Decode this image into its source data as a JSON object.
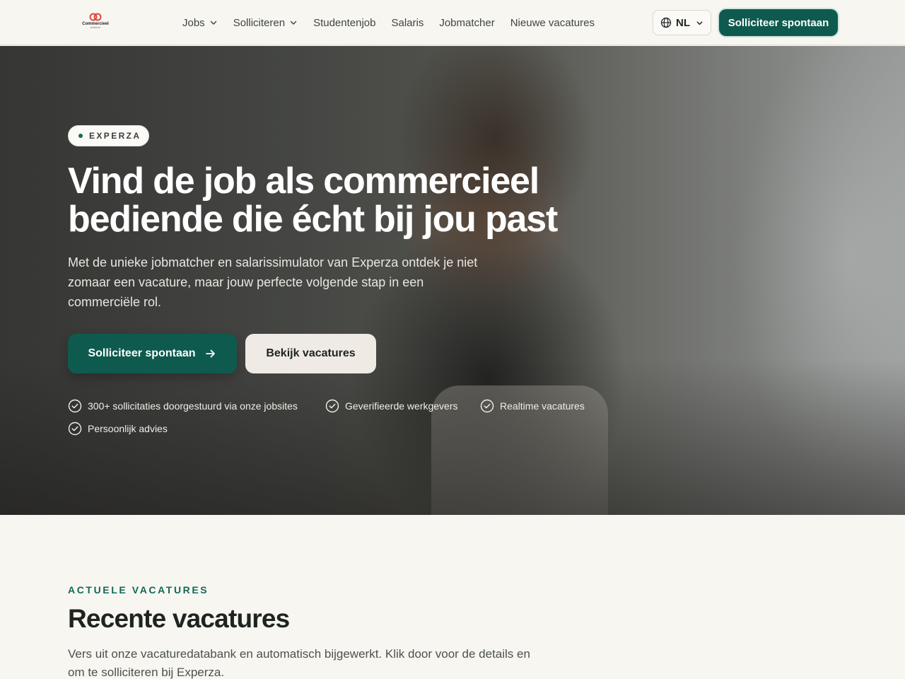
{
  "header": {
    "logo": {
      "text": "Commercieel",
      "sub": "bediende"
    },
    "nav": [
      {
        "label": "Jobs",
        "has_dropdown": true
      },
      {
        "label": "Solliciteren",
        "has_dropdown": true
      },
      {
        "label": "Studentenjob",
        "has_dropdown": false
      },
      {
        "label": "Salaris",
        "has_dropdown": false
      },
      {
        "label": "Jobmatcher",
        "has_dropdown": false
      },
      {
        "label": "Nieuwe vacatures",
        "has_dropdown": false
      }
    ],
    "language": "NL",
    "cta_label": "Solliciteer spontaan"
  },
  "hero": {
    "badge": "EXPERZA",
    "title": "Vind de job als commercieel bediende die écht bij jou past",
    "description": "Met de unieke jobmatcher en salarissimulator van Experza ontdek je niet zomaar een vacature, maar jouw perfecte volgende stap in een commerciële rol.",
    "primary_button": "Solliciteer spontaan",
    "secondary_button": "Bekijk vacatures",
    "features": [
      "300+ sollicitaties doorgestuurd via onze jobsites",
      "Geverifieerde werkgevers",
      "Realtime vacatures",
      "Persoonlijk advies"
    ]
  },
  "vacancies_section": {
    "kicker": "ACTUELE VACATURES",
    "title": "Recente vacatures",
    "description": "Vers uit onze vacaturedatabank en automatisch bijgewerkt. Klik door voor de details en om te solliciteren bij Experza."
  },
  "colors": {
    "brand_green": "#0f5a4e",
    "page_background": "#f8f6f1",
    "logo_red": "#d9483b"
  },
  "icons": [
    "chevron-down-icon",
    "globe-icon",
    "arrow-right-icon",
    "check-circle-icon"
  ]
}
